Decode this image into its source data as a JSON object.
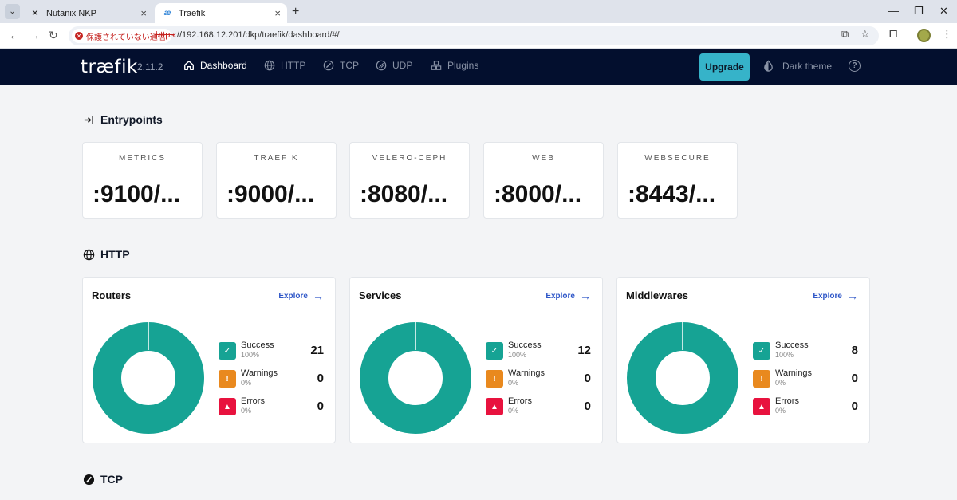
{
  "browser": {
    "tabs": [
      {
        "title": "Nutanix NKP",
        "favicon": "x-logo-icon"
      },
      {
        "title": "Traefik",
        "favicon": "traefik-icon"
      }
    ],
    "security_label": "保護されていない通信",
    "url_scheme": "https",
    "url_rest": "://192.168.12.201/dkp/traefik/dashboard/#/"
  },
  "navbar": {
    "logo": "træfik",
    "version": "2.11.2",
    "items": [
      {
        "label": "Dashboard",
        "icon": "home-icon"
      },
      {
        "label": "HTTP",
        "icon": "globe-icon"
      },
      {
        "label": "TCP",
        "icon": "tcp-icon"
      },
      {
        "label": "UDP",
        "icon": "udp-icon"
      },
      {
        "label": "Plugins",
        "icon": "plugins-icon"
      }
    ],
    "upgrade_label": "Upgrade",
    "theme_label": "Dark theme"
  },
  "entrypoints": {
    "title": "Entrypoints",
    "items": [
      {
        "name": "METRICS",
        "port": ":9100/..."
      },
      {
        "name": "TRAEFIK",
        "port": ":9000/..."
      },
      {
        "name": "VELERO-CEPH",
        "port": ":8080/..."
      },
      {
        "name": "WEB",
        "port": ":8000/..."
      },
      {
        "name": "WEBSECURE",
        "port": ":8443/..."
      }
    ]
  },
  "http": {
    "title": "HTTP",
    "explore_label": "Explore",
    "cards": [
      {
        "title": "Routers",
        "stats": [
          {
            "label": "Success",
            "pct": "100%",
            "value": "21"
          },
          {
            "label": "Warnings",
            "pct": "0%",
            "value": "0"
          },
          {
            "label": "Errors",
            "pct": "0%",
            "value": "0"
          }
        ]
      },
      {
        "title": "Services",
        "stats": [
          {
            "label": "Success",
            "pct": "100%",
            "value": "12"
          },
          {
            "label": "Warnings",
            "pct": "0%",
            "value": "0"
          },
          {
            "label": "Errors",
            "pct": "0%",
            "value": "0"
          }
        ]
      },
      {
        "title": "Middlewares",
        "stats": [
          {
            "label": "Success",
            "pct": "100%",
            "value": "8"
          },
          {
            "label": "Warnings",
            "pct": "0%",
            "value": "0"
          },
          {
            "label": "Errors",
            "pct": "0%",
            "value": "0"
          }
        ]
      }
    ]
  },
  "tcp": {
    "title": "TCP"
  },
  "colors": {
    "success": "#16a394",
    "warning": "#e9891e",
    "error": "#e8123e",
    "navbar": "#030f2e",
    "upgrade": "#36b3c9"
  }
}
